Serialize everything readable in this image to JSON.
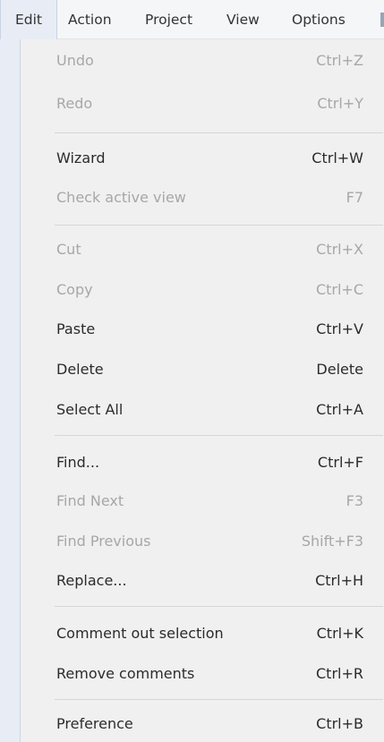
{
  "menubar": {
    "items": [
      {
        "label": "Edit"
      },
      {
        "label": "Action"
      },
      {
        "label": "Project"
      },
      {
        "label": "View"
      },
      {
        "label": "Options"
      }
    ]
  },
  "edit_menu": {
    "items": [
      {
        "label": "Undo",
        "shortcut": "Ctrl+Z",
        "enabled": false
      },
      {
        "label": "Redo",
        "shortcut": "Ctrl+Y",
        "enabled": false
      },
      {
        "label": "Wizard",
        "shortcut": "Ctrl+W",
        "enabled": true
      },
      {
        "label": "Check active view",
        "shortcut": "F7",
        "enabled": false
      },
      {
        "label": "Cut",
        "shortcut": "Ctrl+X",
        "enabled": false
      },
      {
        "label": "Copy",
        "shortcut": "Ctrl+C",
        "enabled": false
      },
      {
        "label": "Paste",
        "shortcut": "Ctrl+V",
        "enabled": true
      },
      {
        "label": "Delete",
        "shortcut": "Delete",
        "enabled": true
      },
      {
        "label": "Select All",
        "shortcut": "Ctrl+A",
        "enabled": true
      },
      {
        "label": "Find...",
        "shortcut": "Ctrl+F",
        "enabled": true
      },
      {
        "label": "Find Next",
        "shortcut": "F3",
        "enabled": false
      },
      {
        "label": "Find Previous",
        "shortcut": "Shift+F3",
        "enabled": false
      },
      {
        "label": "Replace...",
        "shortcut": "Ctrl+H",
        "enabled": true
      },
      {
        "label": "Comment out selection",
        "shortcut": "Ctrl+K",
        "enabled": true
      },
      {
        "label": "Remove comments",
        "shortcut": "Ctrl+R",
        "enabled": true
      },
      {
        "label": "Preference",
        "shortcut": "Ctrl+B",
        "enabled": true
      }
    ]
  },
  "colors": {
    "enabled_text": "#2b2b2b",
    "disabled_text": "#a7a7a7",
    "menu_background": "#f0f0f0",
    "active_menu_highlight": "#e8edf5"
  }
}
